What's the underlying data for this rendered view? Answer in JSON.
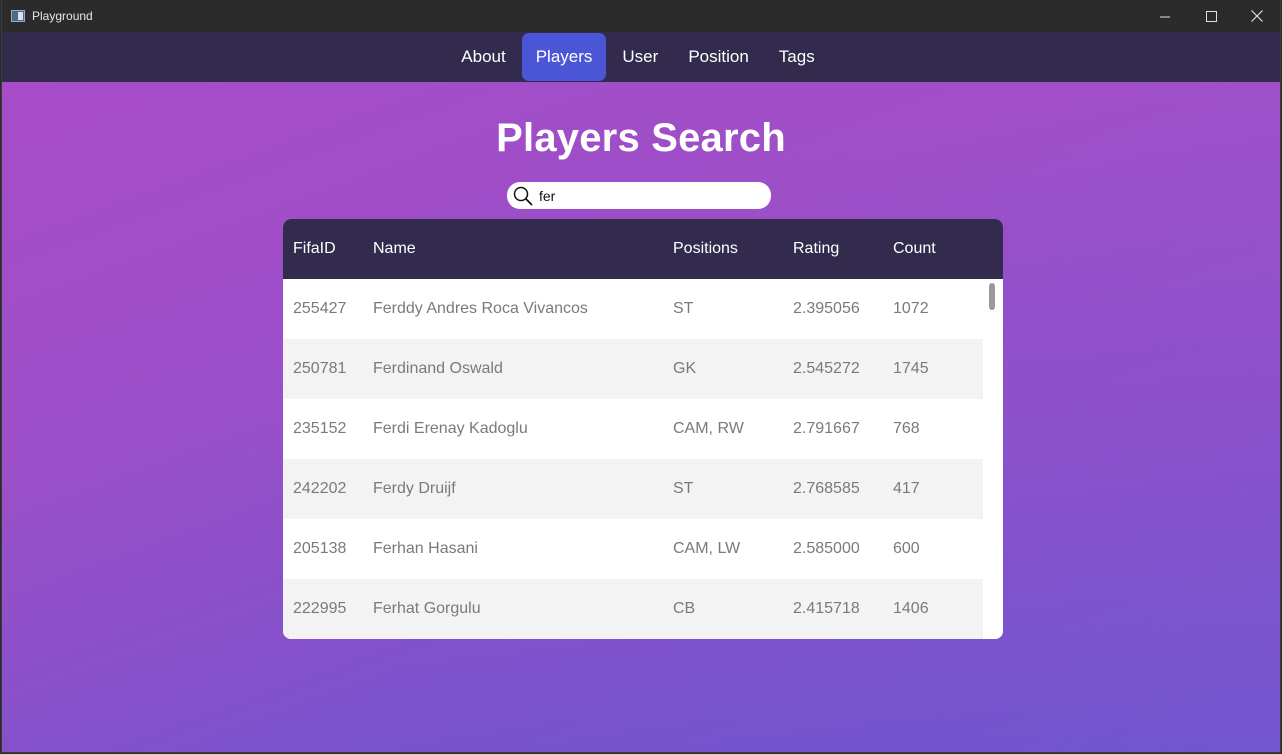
{
  "window": {
    "title": "Playground"
  },
  "nav": {
    "tabs": [
      {
        "label": "About",
        "active": false
      },
      {
        "label": "Players",
        "active": true
      },
      {
        "label": "User",
        "active": false
      },
      {
        "label": "Position",
        "active": false
      },
      {
        "label": "Tags",
        "active": false
      }
    ]
  },
  "page": {
    "title": "Players Search"
  },
  "search": {
    "value": "fer",
    "icon": "search-icon"
  },
  "table": {
    "columns": [
      "FifaID",
      "Name",
      "Positions",
      "Rating",
      "Count"
    ],
    "rows": [
      [
        "255427",
        "Ferddy Andres Roca Vivancos",
        "ST",
        "2.395056",
        "1072"
      ],
      [
        "250781",
        "Ferdinand Oswald",
        "GK",
        "2.545272",
        "1745"
      ],
      [
        "235152",
        "Ferdi Erenay Kadoglu",
        "CAM, RW",
        "2.791667",
        "768"
      ],
      [
        "242202",
        "Ferdy Druijf",
        "ST",
        "2.768585",
        "417"
      ],
      [
        "205138",
        "Ferhan Hasani",
        "CAM, LW",
        "2.585000",
        "600"
      ],
      [
        "222995",
        "Ferhat Gorgulu",
        "CB",
        "2.415718",
        "1406"
      ]
    ]
  },
  "colors": {
    "nav_bg": "#332b4d",
    "active_tab": "#4a56d6",
    "gradient_top": "#a84cc8",
    "gradient_bottom": "#5458d2"
  }
}
